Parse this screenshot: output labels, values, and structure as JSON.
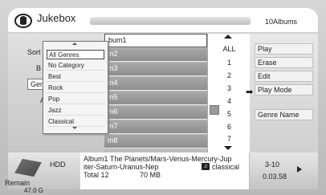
{
  "title": "Jukebox",
  "album_count": "10Albums",
  "left_panel": {
    "sort_label": "Sort",
    "b_label": "B",
    "genre_label": "Gen",
    "a_label": "A"
  },
  "albums": [
    {
      "name": "bum1",
      "selected": true
    },
    {
      "name": "m2"
    },
    {
      "name": "m3"
    },
    {
      "name": "m4"
    },
    {
      "name": "m5"
    },
    {
      "name": "m6"
    },
    {
      "name": "m7"
    },
    {
      "name": "m8"
    }
  ],
  "numbers": [
    "ALL",
    "1",
    "2",
    "3",
    "4",
    "5",
    "6",
    "7"
  ],
  "right_menu": [
    "Play",
    "Erase",
    "Edit",
    "Play Mode",
    "Genre Name"
  ],
  "pointer": "➡",
  "genre_popup": {
    "items": [
      "All Genres",
      "No Category",
      "Best",
      "Rock",
      "Pop",
      "Jazz",
      "Classical"
    ],
    "selected_index": 0
  },
  "bottom": {
    "hdd_label": "HDD",
    "remain_label": "Remain",
    "remain_value": "47.0 G",
    "info_line1": "Album1  The Planets/Mars-Venus-Mercury-Jup",
    "info_line2": "iter-Saturn-Uranus-Nep",
    "total": "Total 12",
    "size": "70 MB",
    "genre": "classical",
    "track_range": "3-10",
    "track_time": "0.03.58"
  }
}
